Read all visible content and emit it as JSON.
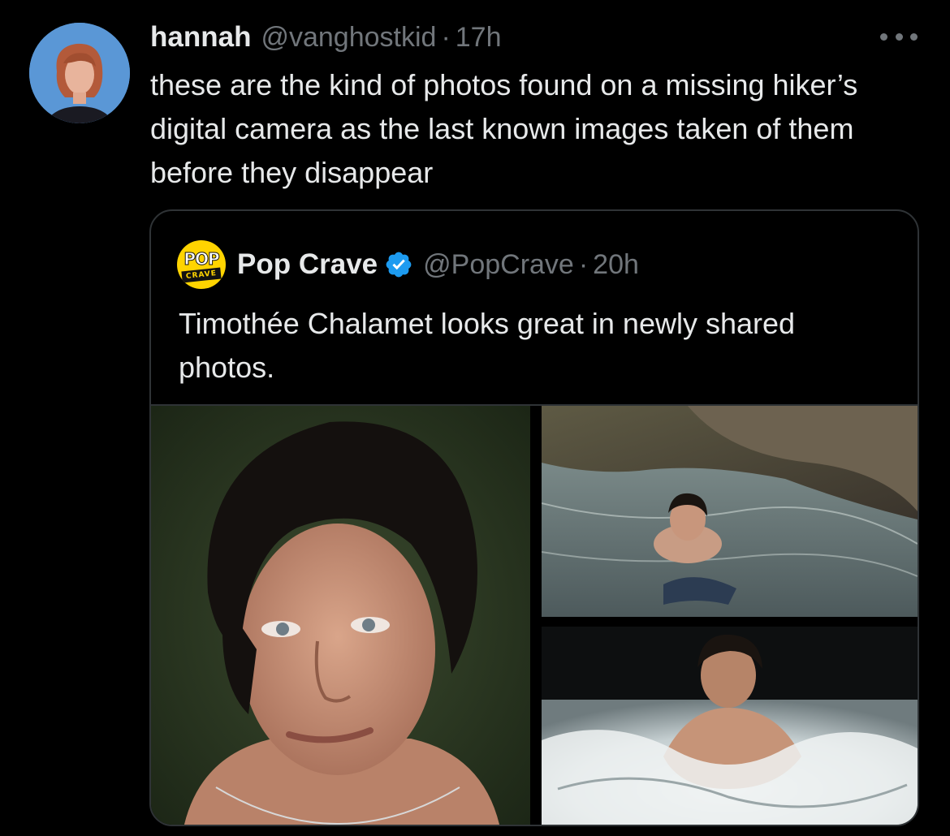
{
  "tweet": {
    "display_name": "hannah",
    "handle": "@vanghostkid",
    "separator": "·",
    "time": "17h",
    "more_icon": "more-horizontal-icon",
    "text": "these are the kind of photos found on a missing hiker’s digital camera as the last known images taken of them before they disappear"
  },
  "quote": {
    "display_name": "Pop Crave",
    "verified_icon": "verified-badge-icon",
    "handle": "@PopCrave",
    "separator": "·",
    "time": "20h",
    "avatar_logo_top": "POP",
    "avatar_logo_bottom": "CRAVE",
    "text": "Timothée Chalamet looks great in newly shared photos.",
    "photo_count": 3
  },
  "colors": {
    "background": "#000000",
    "primary_text": "#e7e9ea",
    "secondary_text": "#71767b",
    "border": "#2f3336",
    "verified_blue": "#1d9bf0",
    "pop_crave_yellow": "#ffd400"
  }
}
